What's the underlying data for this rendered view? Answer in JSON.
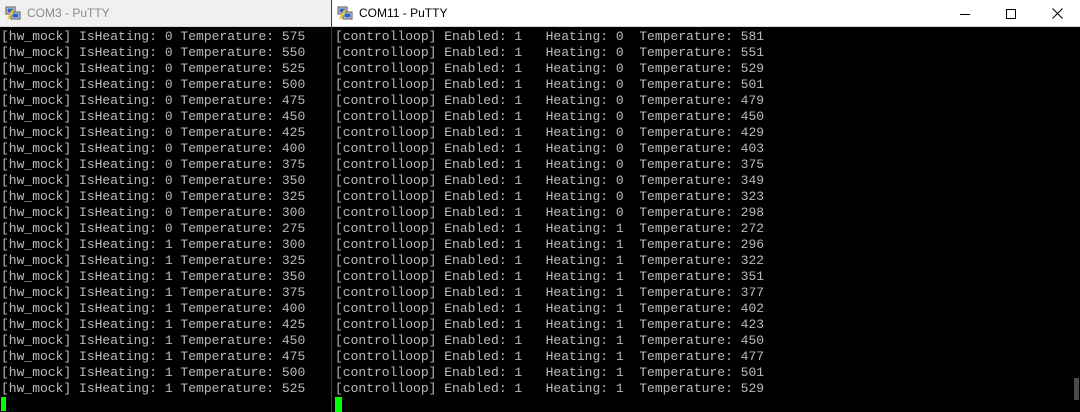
{
  "left_window": {
    "title": "COM3 - PuTTY",
    "icon": "putty-icon",
    "lines": [
      "[hw_mock] IsHeating: 0 Temperature: 575",
      "[hw_mock] IsHeating: 0 Temperature: 550",
      "[hw_mock] IsHeating: 0 Temperature: 525",
      "[hw_mock] IsHeating: 0 Temperature: 500",
      "[hw_mock] IsHeating: 0 Temperature: 475",
      "[hw_mock] IsHeating: 0 Temperature: 450",
      "[hw_mock] IsHeating: 0 Temperature: 425",
      "[hw_mock] IsHeating: 0 Temperature: 400",
      "[hw_mock] IsHeating: 0 Temperature: 375",
      "[hw_mock] IsHeating: 0 Temperature: 350",
      "[hw_mock] IsHeating: 0 Temperature: 325",
      "[hw_mock] IsHeating: 0 Temperature: 300",
      "[hw_mock] IsHeating: 0 Temperature: 275",
      "[hw_mock] IsHeating: 1 Temperature: 300",
      "[hw_mock] IsHeating: 1 Temperature: 325",
      "[hw_mock] IsHeating: 1 Temperature: 350",
      "[hw_mock] IsHeating: 1 Temperature: 375",
      "[hw_mock] IsHeating: 1 Temperature: 400",
      "[hw_mock] IsHeating: 1 Temperature: 425",
      "[hw_mock] IsHeating: 1 Temperature: 450",
      "[hw_mock] IsHeating: 1 Temperature: 475",
      "[hw_mock] IsHeating: 1 Temperature: 500",
      "[hw_mock] IsHeating: 1 Temperature: 525"
    ]
  },
  "right_window": {
    "title": "COM11 - PuTTY",
    "icon": "putty-icon",
    "controls": [
      "minimize-icon",
      "maximize-icon",
      "close-icon"
    ],
    "lines": [
      "[controlloop] Enabled: 1   Heating: 0  Temperature: 581",
      "[controlloop] Enabled: 1   Heating: 0  Temperature: 551",
      "[controlloop] Enabled: 1   Heating: 0  Temperature: 529",
      "[controlloop] Enabled: 1   Heating: 0  Temperature: 501",
      "[controlloop] Enabled: 1   Heating: 0  Temperature: 479",
      "[controlloop] Enabled: 1   Heating: 0  Temperature: 450",
      "[controlloop] Enabled: 1   Heating: 0  Temperature: 429",
      "[controlloop] Enabled: 1   Heating: 0  Temperature: 403",
      "[controlloop] Enabled: 1   Heating: 0  Temperature: 375",
      "[controlloop] Enabled: 1   Heating: 0  Temperature: 349",
      "[controlloop] Enabled: 1   Heating: 0  Temperature: 323",
      "[controlloop] Enabled: 1   Heating: 0  Temperature: 298",
      "[controlloop] Enabled: 1   Heating: 1  Temperature: 272",
      "[controlloop] Enabled: 1   Heating: 1  Temperature: 296",
      "[controlloop] Enabled: 1   Heating: 1  Temperature: 322",
      "[controlloop] Enabled: 1   Heating: 1  Temperature: 351",
      "[controlloop] Enabled: 1   Heating: 1  Temperature: 377",
      "[controlloop] Enabled: 1   Heating: 1  Temperature: 402",
      "[controlloop] Enabled: 1   Heating: 1  Temperature: 423",
      "[controlloop] Enabled: 1   Heating: 1  Temperature: 450",
      "[controlloop] Enabled: 1   Heating: 1  Temperature: 477",
      "[controlloop] Enabled: 1   Heating: 1  Temperature: 501",
      "[controlloop] Enabled: 1   Heating: 1  Temperature: 529"
    ]
  },
  "colors": {
    "terminal_bg": "#000000",
    "terminal_fg": "#bbbbbb",
    "cursor": "#00ff00"
  }
}
